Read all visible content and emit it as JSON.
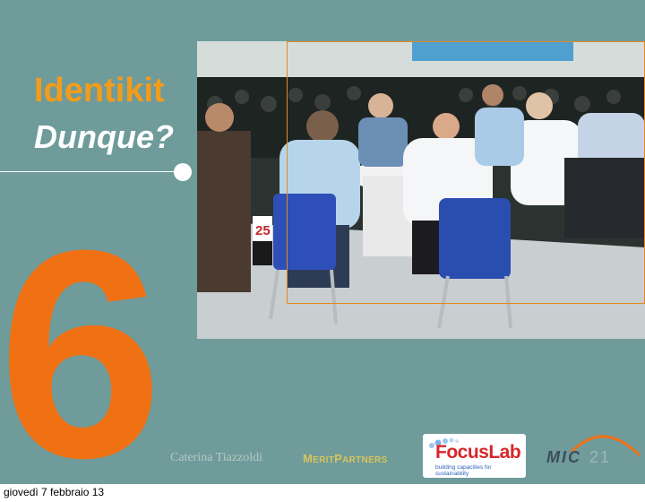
{
  "slide": {
    "title_line1": "Identikit",
    "title_line2": "Dunque?",
    "big_number": "6",
    "photo_sign": "25"
  },
  "footer": {
    "author": "Caterina Tiazzoldi",
    "merit_first": "M",
    "merit_rest1": "ERIT",
    "merit_p": "P",
    "merit_rest2": "ARTNERS",
    "focuslab_name": "FocusLab",
    "focuslab_tagline": "building capacities for sustainability",
    "mic_word": "MIC",
    "mic_number": "21",
    "date": "giovedì 7 febbraio 13"
  },
  "colors": {
    "background": "#6f9b9b",
    "title_orange": "#f39c1a",
    "number_orange": "#f07014",
    "frame_orange": "#e48a1d"
  }
}
